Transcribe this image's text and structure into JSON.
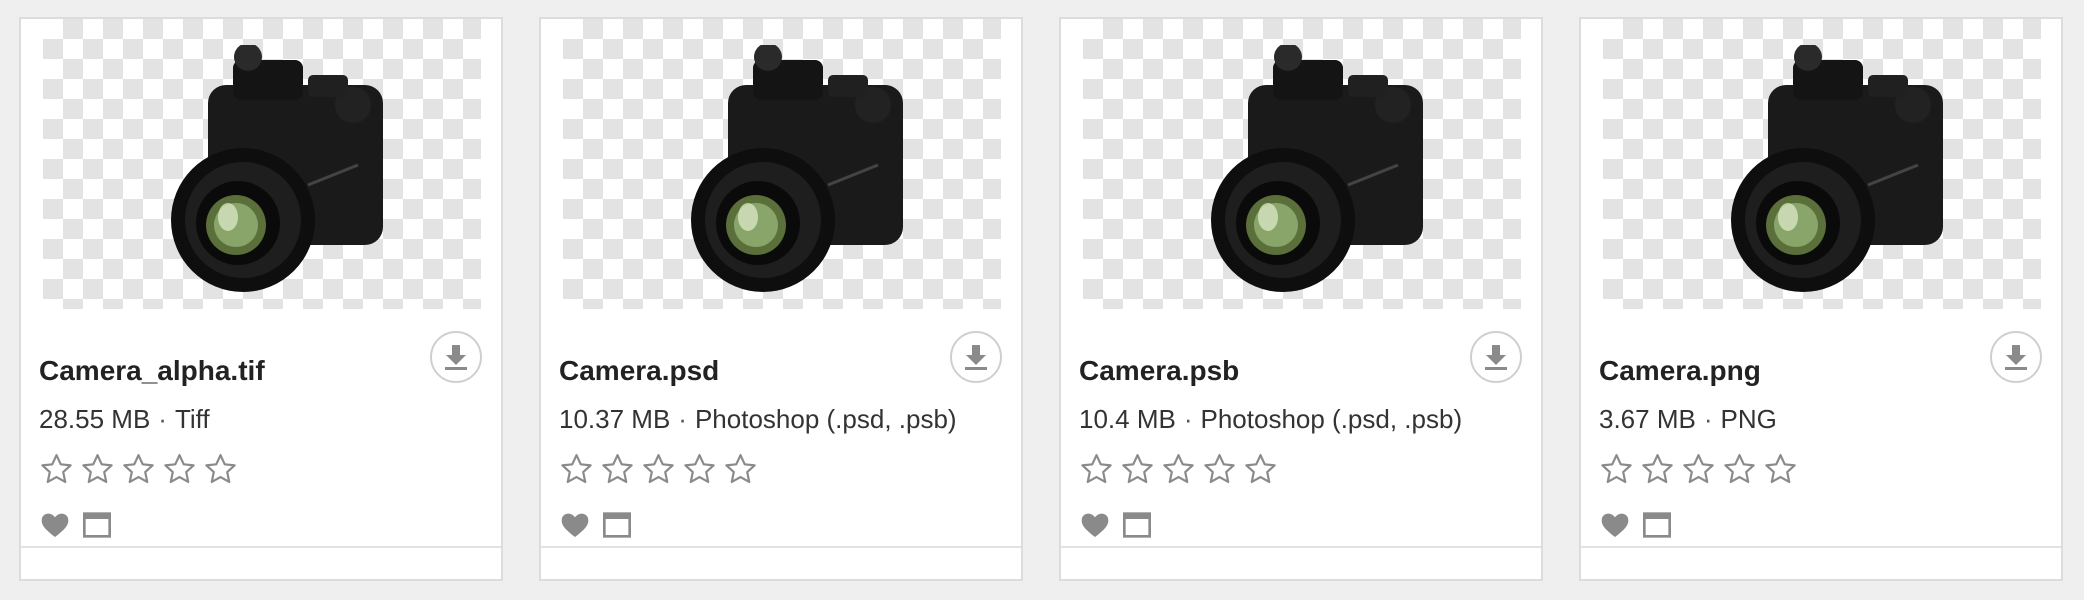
{
  "assets": [
    {
      "title": "Camera_alpha.tif",
      "size": "28.55 MB",
      "separator": "·",
      "format": "Tiff",
      "rating": 0,
      "max_rating": 5
    },
    {
      "title": "Camera.psd",
      "size": "10.37 MB",
      "separator": "·",
      "format": "Photoshop (.psd, .psb)",
      "rating": 0,
      "max_rating": 5
    },
    {
      "title": "Camera.psb",
      "size": "10.4 MB",
      "separator": "·",
      "format": "Photoshop (.psd, .psb)",
      "rating": 0,
      "max_rating": 5
    },
    {
      "title": "Camera.png",
      "size": "3.67 MB",
      "separator": "·",
      "format": "PNG",
      "rating": 0,
      "max_rating": 5
    }
  ],
  "icons": {
    "download": "download-icon",
    "star": "star-outline-icon",
    "favorite": "heart-icon",
    "preview": "window-icon"
  },
  "colors": {
    "icon_gray": "#8a8a8a",
    "title_text": "#222222",
    "card_border": "#dcdcdc",
    "checker": "#e3e3e3"
  }
}
